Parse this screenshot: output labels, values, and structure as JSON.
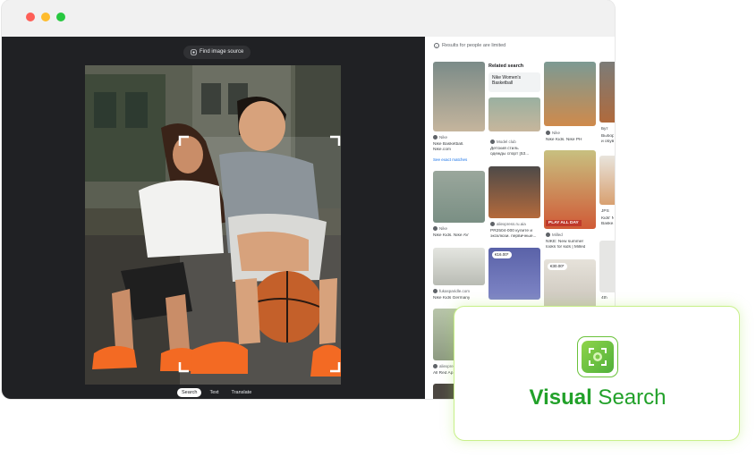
{
  "viewer": {
    "find_button": "Find image source",
    "tabs": [
      "Search",
      "Text",
      "Translate"
    ]
  },
  "results": {
    "notice": "Results for people are limited",
    "related_title": "Related search",
    "related_chip": "Nike Women's Basketball",
    "col1": [
      {
        "source": "Nike",
        "title1": "Nike Basketball.",
        "title2": "Nike.com",
        "link": "See exact matches"
      },
      {
        "source": "Nike",
        "title1": "Nike Kids. Nike AV"
      },
      {
        "source": "fukasparidle.com",
        "title1": "Nike Kids Germany"
      },
      {
        "source": "aliexpress",
        "title1": "All Red Ap..."
      }
    ],
    "col2": [
      {
        "source": "Model club",
        "title1": "Детский стиль",
        "title2": "одежды спорт [53..."
      },
      {
        "source": "aliexpress.ru.aia",
        "title1": "PR2504-000 кулите и",
        "title2": "эксклюзи. первичные..."
      },
      {
        "price": "€16.00*"
      }
    ],
    "col3": [
      {
        "source": "Nike",
        "title1": "Nike Kids. Nike PH"
      },
      {
        "source": "Milled",
        "title1": "NIKE: New summer",
        "title2": "looks for kids | Milled",
        "badge": "PLAY ALL DAY"
      },
      {
        "price": "€30.00*"
      }
    ],
    "col4": [
      {
        "source": "Бут",
        "title1": "Выбор",
        "title2": "и обув..."
      },
      {
        "source": "JPS",
        "title1": "Kids' N",
        "title2": "Baske..."
      },
      {
        "source": "4th"
      }
    ]
  },
  "visual_search": {
    "title_bold": "Visual",
    "title_rest": " Search"
  },
  "colors": {
    "window_chrome": "#f1f1f1",
    "viewer_bg": "#202124",
    "accent_green": "#22a12a",
    "card_glow": "#c8f08a",
    "close": "#fe5f57",
    "minimize": "#febc2e",
    "maximize": "#28c840"
  }
}
